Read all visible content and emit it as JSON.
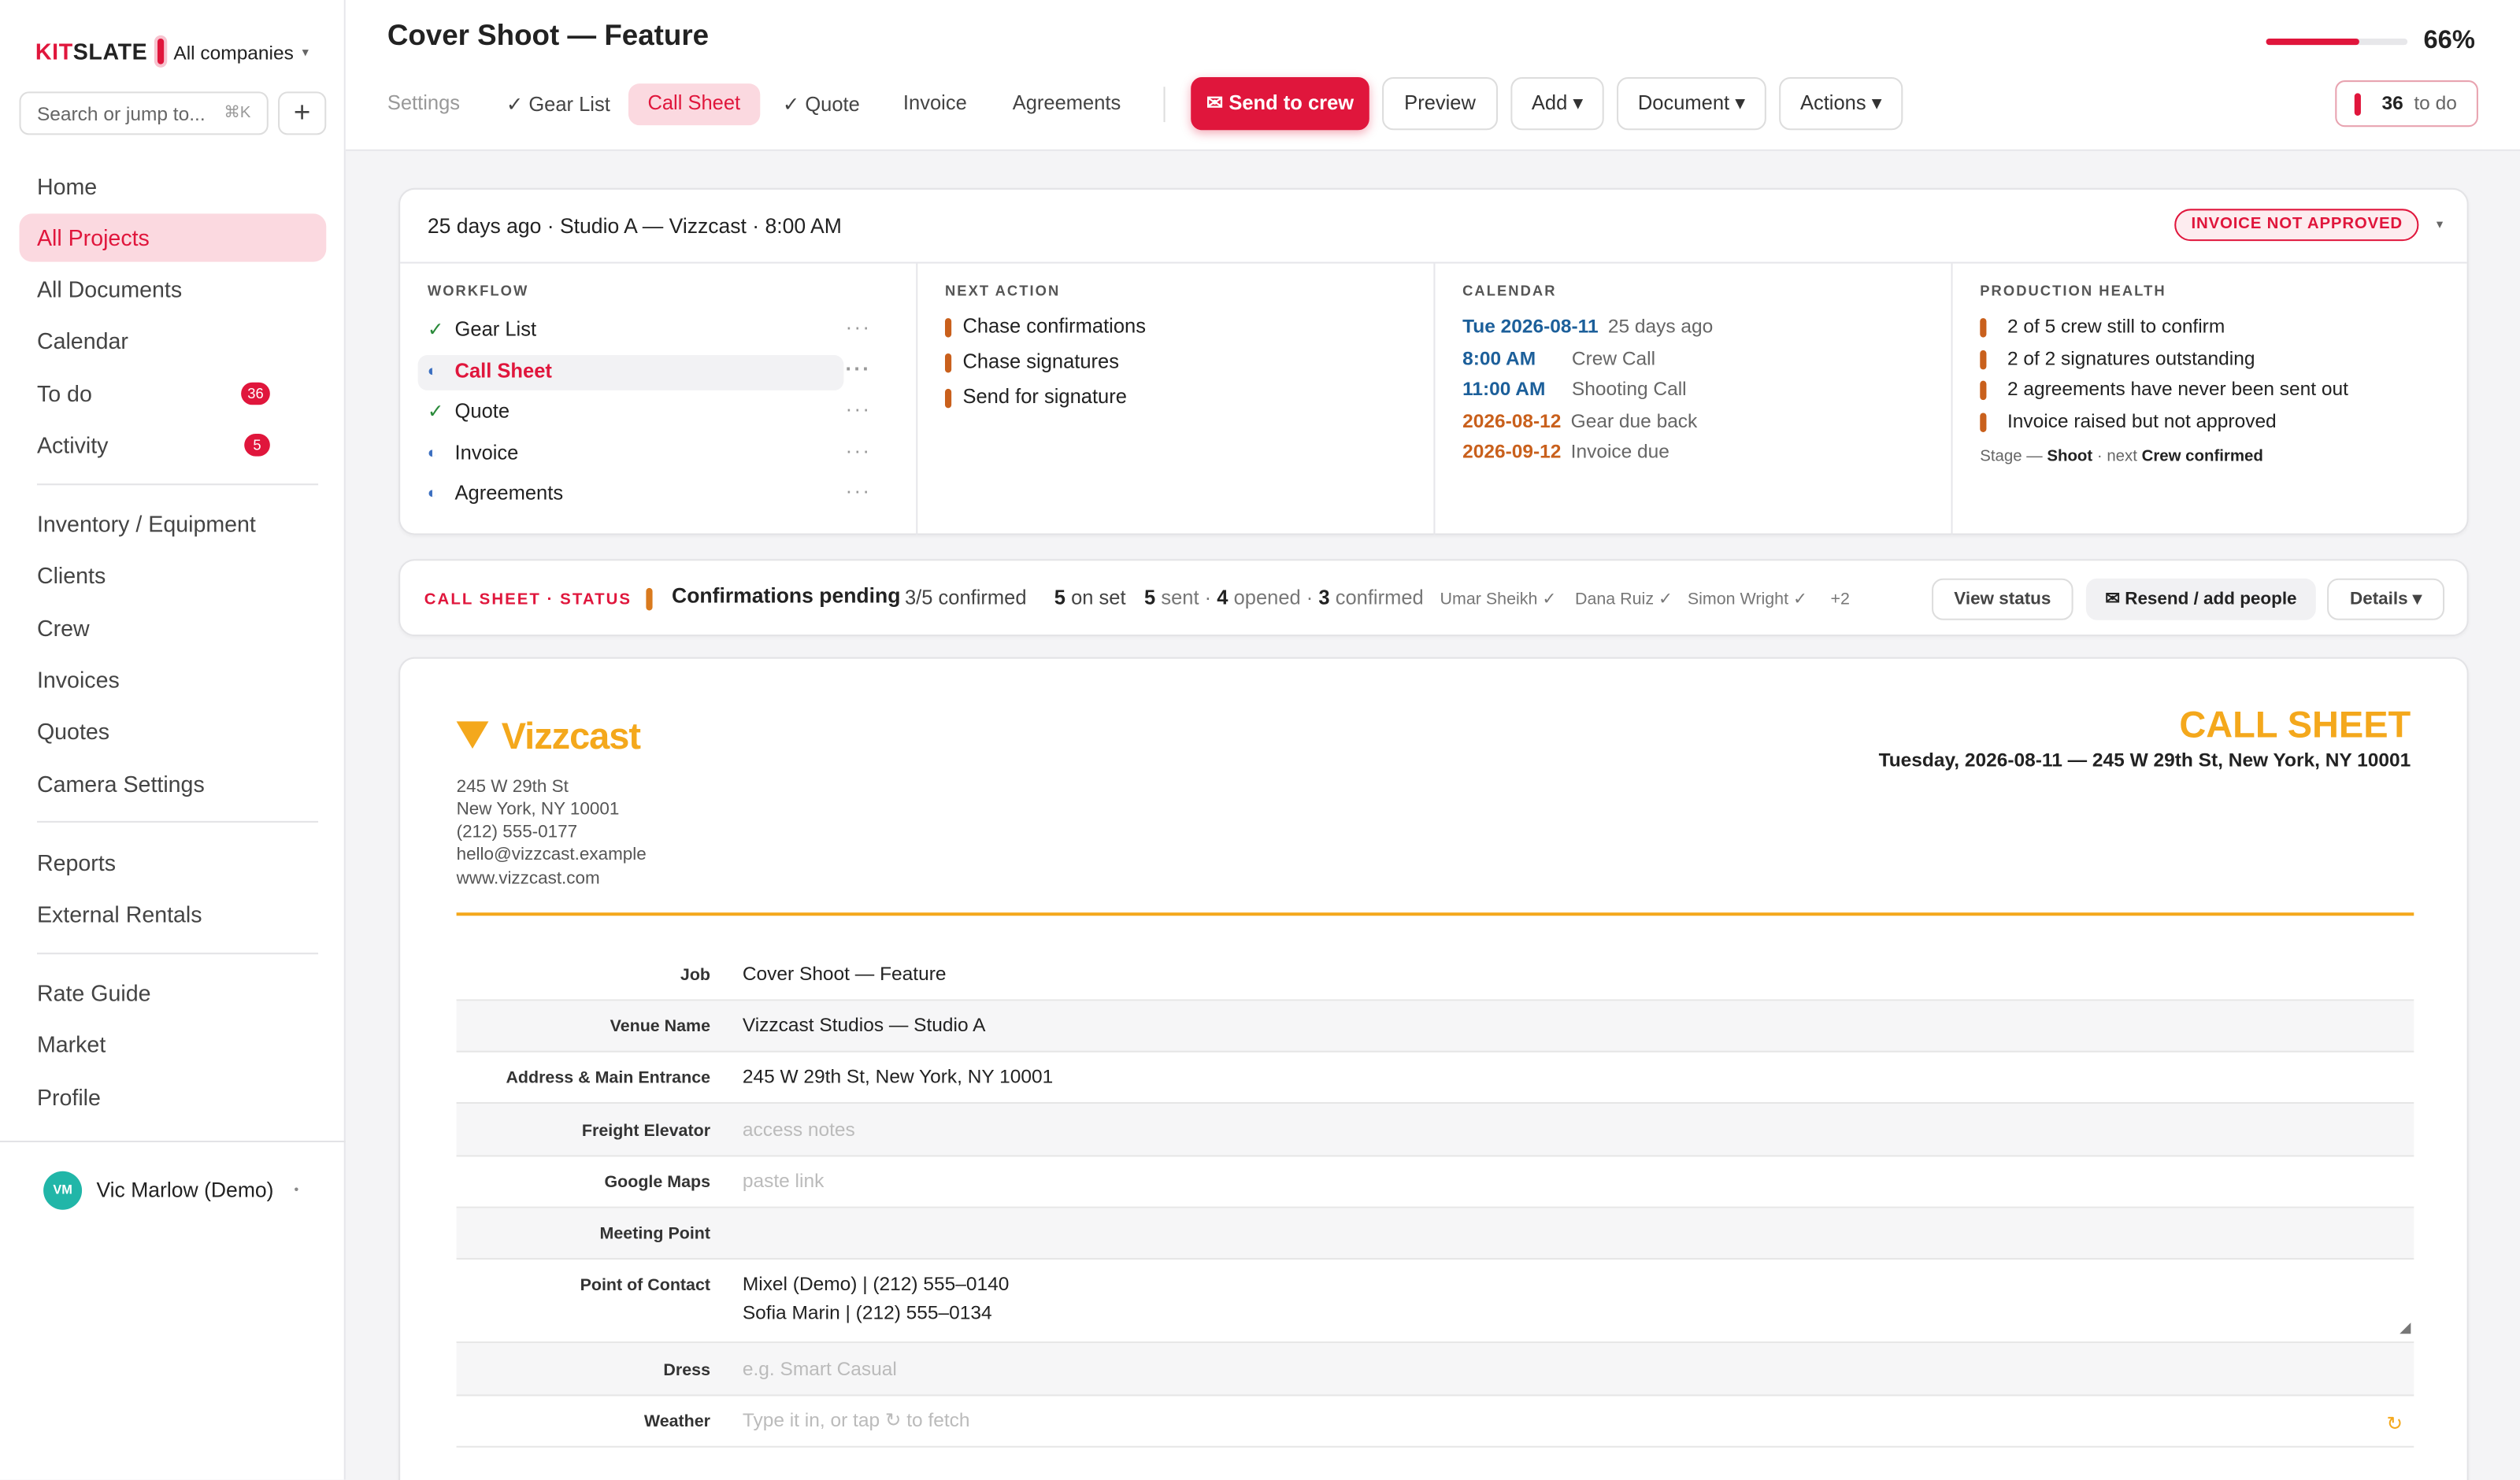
{
  "app": {
    "logo_prefix": "KIT",
    "logo_rest": "SLATE",
    "company": "All companies",
    "search_placeholder": "Search or jump to...",
    "search_shortcut": "⌘K",
    "add": "+"
  },
  "sidebar": {
    "items": [
      {
        "label": "Home"
      },
      {
        "label": "All Projects",
        "active": true
      },
      {
        "label": "All Documents"
      },
      {
        "label": "Calendar"
      },
      {
        "label": "To do",
        "badge": "36"
      },
      {
        "label": "Activity",
        "badge": "5"
      },
      {
        "label": "Inventory / Equipment"
      },
      {
        "label": "Clients"
      },
      {
        "label": "Crew"
      },
      {
        "label": "Invoices"
      },
      {
        "label": "Quotes"
      },
      {
        "label": "Camera Settings"
      },
      {
        "label": "Reports"
      },
      {
        "label": "External Rentals"
      },
      {
        "label": "Rate Guide"
      },
      {
        "label": "Market"
      },
      {
        "label": "Profile"
      }
    ],
    "user": {
      "initials": "VM",
      "name": "Vic Marlow (Demo)"
    }
  },
  "header": {
    "title": "Cover Shoot — Feature",
    "tabs": [
      "Settings",
      "✓ Gear List",
      "Call Sheet",
      "✓ Quote",
      "Invoice",
      "Agreements"
    ],
    "buttons": {
      "send": "✉ Send to crew",
      "preview": "Preview",
      "add": "Add ▾",
      "document": "Document ▾",
      "actions": "Actions ▾"
    },
    "progress": {
      "value": 0.66,
      "label": "66%"
    },
    "todo": {
      "count": "36",
      "label": "to do"
    }
  },
  "summary": {
    "headline": "25 days ago · Studio A — Vizzcast · 8:00 AM",
    "badge": "INVOICE NOT APPROVED",
    "workflow": {
      "title": "WORKFLOW",
      "items": [
        {
          "label": "Gear List",
          "state": "done"
        },
        {
          "label": "Call Sheet",
          "state": "partial"
        },
        {
          "label": "Quote",
          "state": "done"
        },
        {
          "label": "Invoice",
          "state": "partial"
        },
        {
          "label": "Agreements",
          "state": "partial"
        }
      ]
    },
    "next_action": {
      "title": "NEXT ACTION",
      "items": [
        "Chase confirmations",
        "Chase signatures",
        "Send for signature"
      ]
    },
    "calendar": {
      "title": "CALENDAR",
      "items": [
        {
          "date": "Tue 2026-08-11",
          "text": "25 days ago",
          "color": "#1c5f9a"
        },
        {
          "date": "8:00 AM",
          "text": "Crew Call",
          "color": "#1c5f9a"
        },
        {
          "date": "11:00 AM",
          "text": "Shooting Call",
          "color": "#1c5f9a"
        },
        {
          "date": "2026-08-12",
          "text": "Gear due back",
          "color": "#c9601c"
        },
        {
          "date": "2026-09-12",
          "text": "Invoice due",
          "color": "#c9601c"
        }
      ]
    },
    "health": {
      "title": "PRODUCTION HEALTH",
      "items": [
        "2 of 5 crew still to confirm",
        "2 of 2 signatures outstanding",
        "2 agreements have never been sent out",
        "Invoice raised but not approved"
      ],
      "stage_prefix": "Stage — ",
      "stage": "Shoot",
      "stage_mid": " · next ",
      "next": "Crew confirmed"
    }
  },
  "status": {
    "label": "CALL SHEET · STATUS",
    "state": "Confirmations pending",
    "confirmed": "3/5 confirmed",
    "on_set_n": "5",
    "on_set": "on set",
    "sent_n": "5",
    "sent": "sent ·",
    "opened_n": "4",
    "opened": "opened ·",
    "conf_n": "3",
    "conf": "confirmed",
    "people": [
      "Umar Sheikh ✓",
      "Dana Ruiz ✓",
      "Simon Wright ✓",
      "+2"
    ],
    "buttons": {
      "view": "View status",
      "resend": "✉ Resend / add people",
      "details": "Details ▾"
    }
  },
  "document": {
    "company": "Vizzcast",
    "address": [
      "245 W 29th St",
      "New York, NY 10001",
      "(212) 555-0177",
      "hello@vizzcast.example",
      "www.vizzcast.com"
    ],
    "title": "CALL SHEET",
    "date_line": "Tuesday, 2026-08-11 — 245 W 29th St, New York, NY 10001",
    "fields": [
      {
        "label": "Job",
        "value": "Cover Shoot — Feature"
      },
      {
        "label": "Venue Name",
        "value": "Vizzcast Studios — Studio A"
      },
      {
        "label": "Address & Main Entrance",
        "value": "245 W 29th St, New York, NY 10001"
      },
      {
        "label": "Freight Elevator",
        "placeholder": "access notes"
      },
      {
        "label": "Google Maps",
        "placeholder": "paste link"
      },
      {
        "label": "Meeting Point",
        "value": ""
      },
      {
        "label": "Point of Contact",
        "value": "Mixel (Demo) | (212) 555–0140",
        "value2": "Sofia Marin | (212) 555–0134"
      },
      {
        "label": "Dress",
        "placeholder": "e.g. Smart Casual"
      },
      {
        "label": "Weather",
        "placeholder": "Type it in, or tap ↻ to fetch"
      }
    ]
  }
}
